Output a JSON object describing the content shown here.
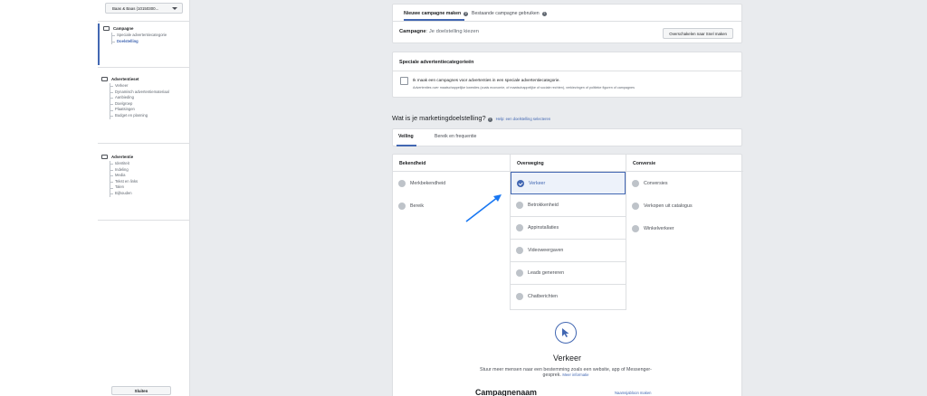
{
  "sidebar": {
    "account": "Baas & Baas (10150300...",
    "sections": [
      {
        "title": "Campagne",
        "items": [
          "Speciale advertentiecategorie",
          "Doelstelling"
        ],
        "active": 1
      },
      {
        "title": "Advertentieset",
        "items": [
          "Verkeer",
          "Dynamisch advertentiemateriaal",
          "Aanbieding",
          "Doelgroep",
          "Plaatsingen",
          "Budget en planning"
        ]
      },
      {
        "title": "Advertentie",
        "items": [
          "Identiteit",
          "Indeling",
          "Media",
          "Tekst en links",
          "Talen",
          "Bijhouden"
        ]
      }
    ],
    "close_label": "Sluiten"
  },
  "top_card": {
    "tabs": [
      "Nieuwe campagne maken",
      "Bestaande campagne gebruiken"
    ],
    "campaign_label": "Campagne",
    "campaign_value": ": Je doelstelling kiezen",
    "quick_button": "Overschakelen naar Snel maken"
  },
  "special": {
    "title": "Speciale advertentiecategorieën",
    "checkbox_label": "Ik maak een campagnes voor advertenties in een speciale advertentiecategorie.",
    "description": "Advertenties over maatschappelijke kwesties (zoals economie, of maatschappelijke of sociale rechten), verkiezingen of politieke figuren of campagnes"
  },
  "objective": {
    "question": "Wat is je marketingdoelstelling?",
    "help_link": "Help: een doelstelling selecteren",
    "tabs": [
      "Veiling",
      "Bereik en frequentie"
    ],
    "columns": [
      {
        "title": "Bekendheid",
        "items": [
          "Merkbekendheid",
          "Bereik"
        ]
      },
      {
        "title": "Overweging",
        "items": [
          "Verkeer",
          "Betrokkenheid",
          "Appinstallaties",
          "Videoweergaven",
          "Leads genereren",
          "Chatberichten"
        ],
        "selected": 0
      },
      {
        "title": "Conversie",
        "items": [
          "Conversies",
          "Verkopen uit catalogus",
          "Winkelverkeer"
        ]
      }
    ],
    "detail_title": "Verkeer",
    "detail_desc": "Stuur meer mensen naar een bestemming zoals een website, app of Messenger-gesprek.",
    "detail_more": "Meer informatie",
    "name_heading": "Campagnenaam",
    "name_template": "Naamsjabloon maken"
  },
  "colors": {
    "accent": "#4267b2",
    "canvas": "#e9ebee",
    "border": "#dddfe2"
  }
}
